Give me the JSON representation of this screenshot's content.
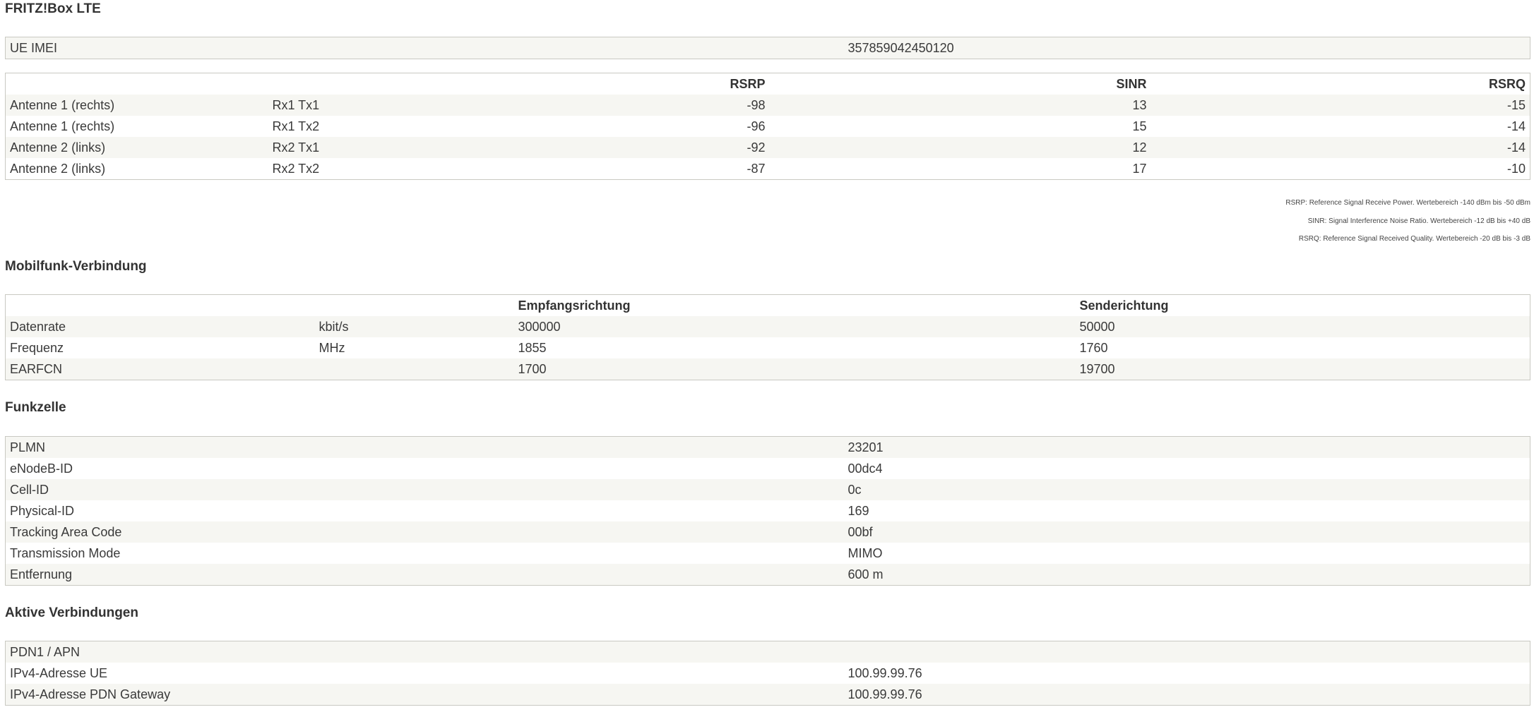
{
  "title": "FRITZ!Box LTE",
  "imei": {
    "label": "UE IMEI",
    "value": "357859042450120"
  },
  "antennas": {
    "headers": {
      "rsrp": "RSRP",
      "sinr": "SINR",
      "rsrq": "RSRQ"
    },
    "rows": [
      {
        "name": "Antenne 1 (rechts)",
        "path": "Rx1 Tx1",
        "rsrp": "-98",
        "sinr": "13",
        "rsrq": "-15"
      },
      {
        "name": "Antenne 1 (rechts)",
        "path": "Rx1 Tx2",
        "rsrp": "-96",
        "sinr": "15",
        "rsrq": "-14"
      },
      {
        "name": "Antenne 2 (links)",
        "path": "Rx2 Tx1",
        "rsrp": "-92",
        "sinr": "12",
        "rsrq": "-14"
      },
      {
        "name": "Antenne 2 (links)",
        "path": "Rx2 Tx2",
        "rsrp": "-87",
        "sinr": "17",
        "rsrq": "-10"
      }
    ],
    "legend": [
      "RSRP: Reference Signal Receive Power. Wertebereich -140 dBm bis -50 dBm",
      "SINR: Signal Interference Noise Ratio. Wertebereich -12 dB bis +40 dB",
      "RSRQ: Reference Signal Received Quality. Wertebereich -20 dB bis -3 dB"
    ]
  },
  "mobile": {
    "heading": "Mobilfunk-Verbindung",
    "headers": {
      "rx": "Empfangsrichtung",
      "tx": "Senderichtung"
    },
    "rows": [
      {
        "label": "Datenrate",
        "unit": "kbit/s",
        "rx": "300000",
        "tx": "50000"
      },
      {
        "label": "Frequenz",
        "unit": "MHz",
        "rx": "1855",
        "tx": "1760"
      },
      {
        "label": "EARFCN",
        "unit": "",
        "rx": "1700",
        "tx": "19700"
      }
    ]
  },
  "cell": {
    "heading": "Funkzelle",
    "rows": [
      {
        "label": "PLMN",
        "value": "23201"
      },
      {
        "label": "eNodeB-ID",
        "value": "00dc4"
      },
      {
        "label": "Cell-ID",
        "value": "0c"
      },
      {
        "label": "Physical-ID",
        "value": "169"
      },
      {
        "label": "Tracking Area Code",
        "value": "00bf"
      },
      {
        "label": "Transmission Mode",
        "value": "MIMO"
      },
      {
        "label": "Entfernung",
        "value": "600 m"
      }
    ]
  },
  "active": {
    "heading": "Aktive Verbindungen",
    "rows": [
      {
        "label": "PDN1 / APN",
        "value": ""
      },
      {
        "label": "IPv4-Adresse UE",
        "value": "100.99.99.76"
      },
      {
        "label": "IPv4-Adresse PDN Gateway",
        "value": "100.99.99.76"
      }
    ]
  }
}
